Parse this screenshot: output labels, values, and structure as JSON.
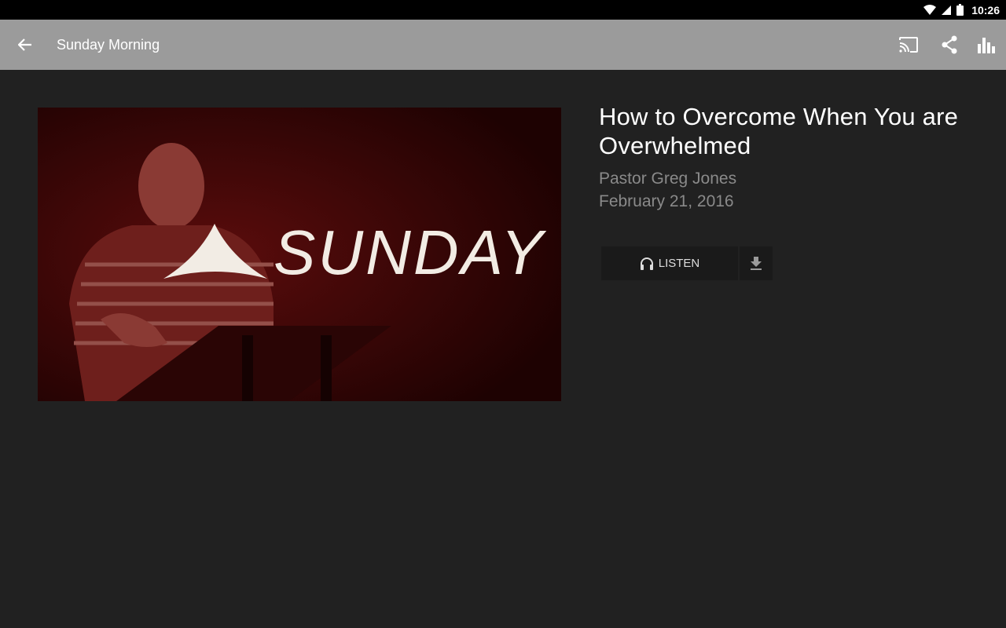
{
  "status_bar": {
    "time": "10:26",
    "icons": [
      "wifi-icon",
      "cell-signal-icon",
      "battery-icon"
    ]
  },
  "app_bar": {
    "title": "Sunday Morning",
    "background": "#9b9b9b",
    "icons": [
      "back-arrow-icon",
      "cast-icon",
      "share-icon",
      "chart-icon"
    ]
  },
  "artwork": {
    "logo_text": "SUNDAY",
    "tint_color": "#3a0606"
  },
  "sermon": {
    "title": "How to Overcome When You are Overwhelmed",
    "speaker": "Pastor Greg Jones",
    "date": "February 21, 2016"
  },
  "controls": {
    "listen_label": "LISTEN",
    "listen_icon": "headphones-icon",
    "download_icon": "download-icon"
  }
}
